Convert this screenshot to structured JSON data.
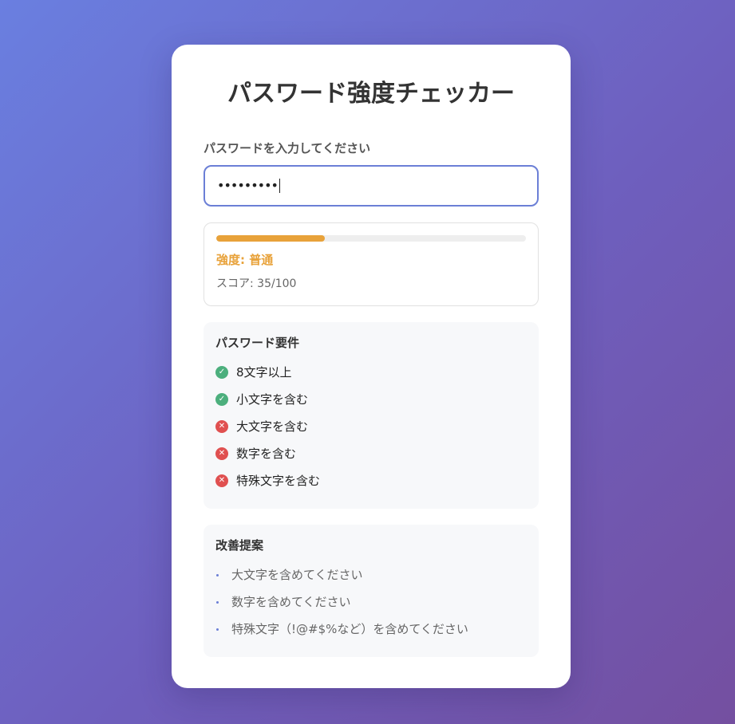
{
  "title": "パスワード強度チェッカー",
  "input": {
    "label": "パスワードを入力してください",
    "value": "•••••••••"
  },
  "strength": {
    "fill_percent": 35,
    "label": "強度: 普通",
    "score": "スコア: 35/100",
    "color": "#e8a23a"
  },
  "requirements": {
    "title": "パスワード要件",
    "items": [
      {
        "text": "8文字以上",
        "met": true,
        "icon": "check-circle-icon"
      },
      {
        "text": "小文字を含む",
        "met": true,
        "icon": "check-circle-icon"
      },
      {
        "text": "大文字を含む",
        "met": false,
        "icon": "x-circle-icon"
      },
      {
        "text": "数字を含む",
        "met": false,
        "icon": "x-circle-icon"
      },
      {
        "text": "特殊文字を含む",
        "met": false,
        "icon": "x-circle-icon"
      }
    ]
  },
  "suggestions": {
    "title": "改善提案",
    "items": [
      {
        "text": "大文字を含めてください"
      },
      {
        "text": "数字を含めてください"
      },
      {
        "text": "特殊文字（!@#$%など）を含めてください"
      }
    ]
  },
  "colors": {
    "accent": "#6b7fd6",
    "success": "#4caf7d",
    "error": "#e05050"
  }
}
